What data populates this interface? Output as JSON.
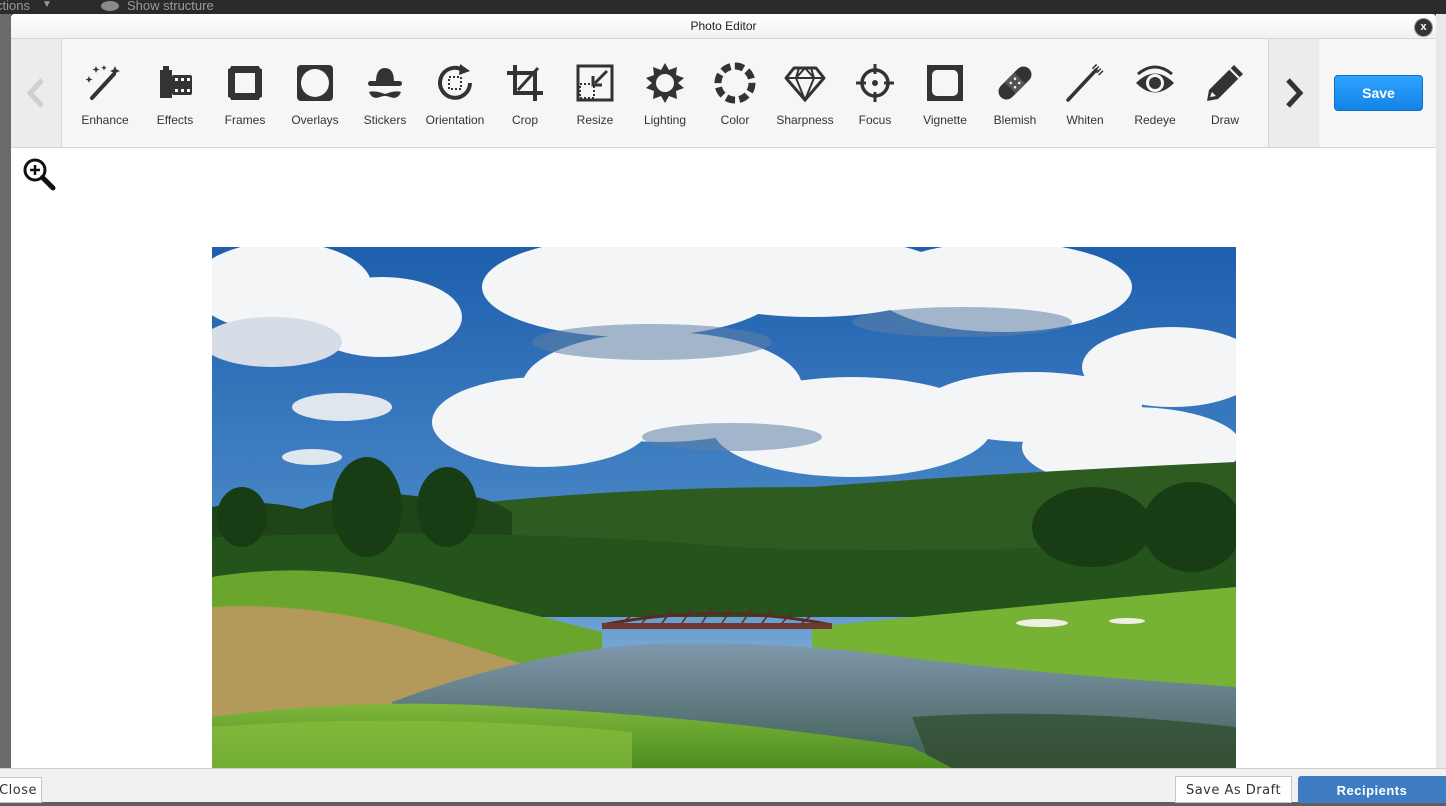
{
  "background": {
    "topbar_left_text": "ctions",
    "topbar_show_structure": "Show structure",
    "close_label": "Close",
    "save_draft_label": "Save As Draft",
    "recipients_label": "Recipients",
    "accent_color": "#3e7cc4"
  },
  "editor": {
    "title": "Photo Editor",
    "close_icon": "close-icon",
    "save_label": "Save",
    "save_color": "#1a8cf0",
    "tools": [
      {
        "label": "Enhance",
        "icon": "magic-wand-icon"
      },
      {
        "label": "Effects",
        "icon": "film-icon"
      },
      {
        "label": "Frames",
        "icon": "frame-icon"
      },
      {
        "label": "Overlays",
        "icon": "overlay-icon"
      },
      {
        "label": "Stickers",
        "icon": "hat-mustache-icon"
      },
      {
        "label": "Orientation",
        "icon": "rotate-icon"
      },
      {
        "label": "Crop",
        "icon": "crop-icon"
      },
      {
        "label": "Resize",
        "icon": "resize-icon"
      },
      {
        "label": "Lighting",
        "icon": "sun-icon"
      },
      {
        "label": "Color",
        "icon": "color-wheel-icon"
      },
      {
        "label": "Sharpness",
        "icon": "diamond-icon"
      },
      {
        "label": "Focus",
        "icon": "crosshair-icon"
      },
      {
        "label": "Vignette",
        "icon": "vignette-icon"
      },
      {
        "label": "Blemish",
        "icon": "bandage-icon"
      },
      {
        "label": "Whiten",
        "icon": "toothbrush-icon"
      },
      {
        "label": "Redeye",
        "icon": "eye-icon"
      },
      {
        "label": "Draw",
        "icon": "pencil-icon"
      }
    ]
  }
}
